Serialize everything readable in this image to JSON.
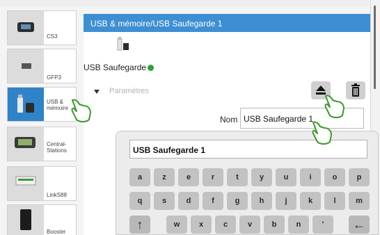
{
  "header": {
    "title": "USB & mémoire/USB Saufegarde 1"
  },
  "sidebar": {
    "items": [
      {
        "label": "CS3",
        "icon": "cs3-station-icon"
      },
      {
        "label": "GFP3",
        "icon": "gfp3-module-icon"
      },
      {
        "label": "USB & mémoire",
        "icon": "usb-memory-icon"
      },
      {
        "label": "Central-Stations",
        "icon": "central-station-icon"
      },
      {
        "label": "LinkS88",
        "icon": "links88-icon"
      },
      {
        "label": "Booster",
        "icon": "booster-icon"
      }
    ],
    "selected": "USB & mémoire"
  },
  "device": {
    "name": "USB Saufegarde"
  },
  "params": {
    "label": "Paramètres"
  },
  "nom": {
    "label": "Nom",
    "value": "USB Saufegarde 1"
  },
  "keyboard": {
    "field_value": "USB Saufegarde 1",
    "row1": [
      "a",
      "z",
      "e",
      "r",
      "t",
      "y",
      "u",
      "i",
      "o",
      "p"
    ],
    "row2": [
      "q",
      "s",
      "d",
      "f",
      "g",
      "h",
      "j",
      "k",
      "l",
      "m"
    ],
    "row3": [
      "w",
      "x",
      "c",
      "v",
      "b",
      "n",
      "'"
    ],
    "shift": "↑",
    "backspace": "←"
  },
  "colors": {
    "header": "#3d8fd3",
    "selected_tile": "#2f83c9",
    "key": "#c2c2c2"
  }
}
